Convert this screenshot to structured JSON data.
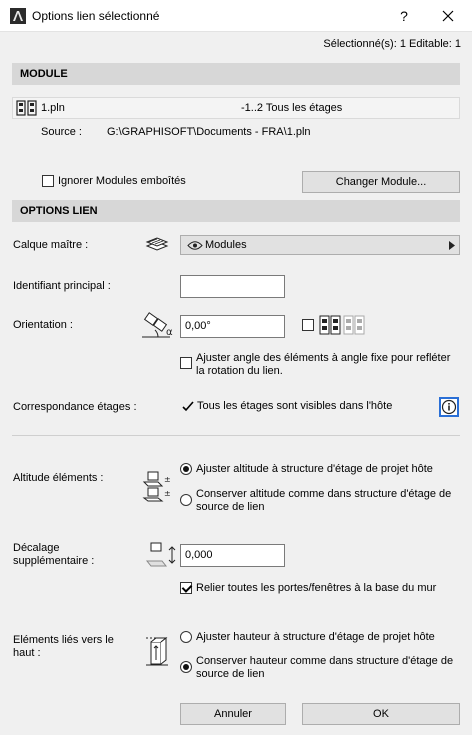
{
  "window": {
    "title": "Options lien sélectionné",
    "help_label": "?",
    "close_icon": "close-icon"
  },
  "selection_info": "Sélectionné(s): 1 Editable: 1",
  "module": {
    "header": "MODULE",
    "file_name": "1.pln",
    "stories": "-1..2 Tous les étages",
    "source_label": "Source :",
    "source_path": "G:\\GRAPHISOFT\\Documents - FRA\\1.pln",
    "ignore_nested_label": "Ignorer Modules emboîtés",
    "ignore_nested_checked": false,
    "change_button": "Changer Module..."
  },
  "link_options": {
    "header": "OPTIONS LIEN",
    "master_layer_label": "Calque maître :",
    "master_layer_value": "Modules",
    "main_id_label": "Identifiant principal :",
    "main_id_value": "",
    "orientation_label": "Orientation :",
    "orientation_value": "0,00°",
    "mirror_checked": false,
    "adjust_angle_label": "Ajuster angle des éléments à angle fixe pour refléter la rotation du lien.",
    "adjust_angle_checked": false,
    "story_match_label": "Correspondance étages :",
    "story_match_value": "Tous les étages sont visibles dans l'hôte",
    "elevation_label": "Altitude éléments :",
    "elevation_options": [
      {
        "label": "Ajuster altitude à structure d'étage de projet hôte",
        "selected": true
      },
      {
        "label": "Conserver altitude comme dans structure d'étage de source de lien",
        "selected": false
      }
    ],
    "offset_label": "Décalage supplémentaire :",
    "offset_value": "0,000",
    "doors_label": "Relier toutes les portes/fenêtres à la base du mur",
    "doors_checked": true,
    "top_linked_label": "Eléments liés vers le haut :",
    "top_options": [
      {
        "label": "Ajuster hauteur à structure d'étage de projet hôte",
        "selected": false
      },
      {
        "label": "Conserver hauteur comme dans structure d'étage de source de lien",
        "selected": true
      }
    ]
  },
  "footer": {
    "cancel": "Annuler",
    "ok": "OK"
  }
}
